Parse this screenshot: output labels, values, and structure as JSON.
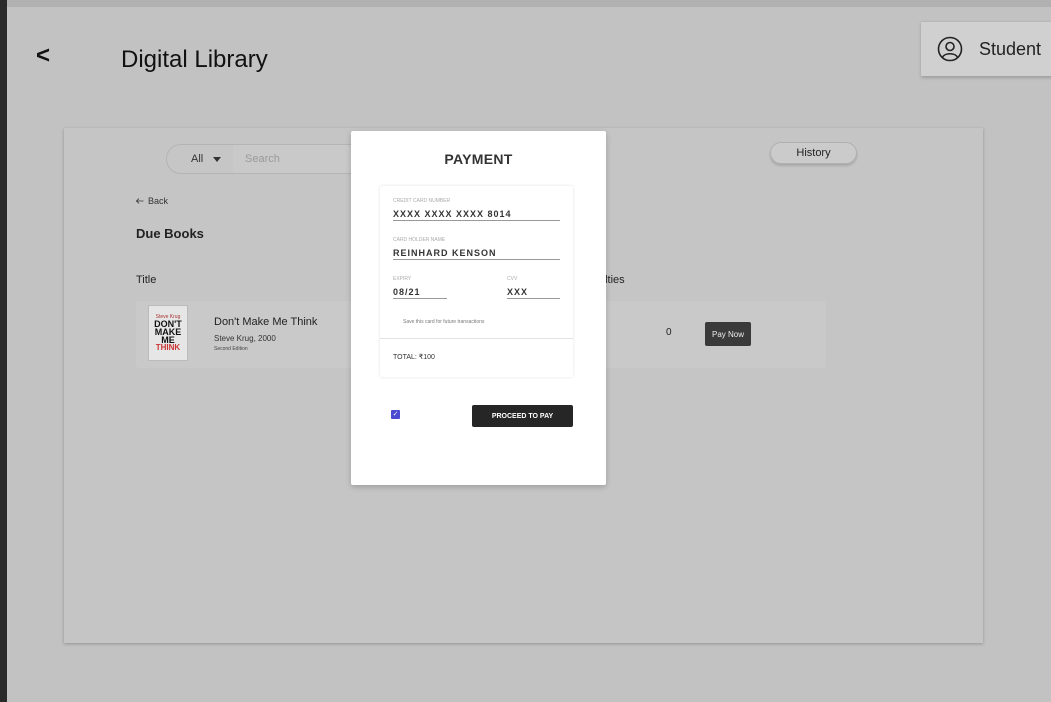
{
  "app": {
    "title": "Digital Library",
    "back_glyph": "<"
  },
  "user": {
    "label": "Student",
    "icon": "user-circle-icon"
  },
  "toolbar": {
    "filter": {
      "selected": "All"
    },
    "search": {
      "placeholder": "Search",
      "value": ""
    },
    "history_label": "History"
  },
  "content": {
    "back_label": "Back",
    "section_title": "Due Books",
    "columns": {
      "title": "Title",
      "penalties": "alties"
    },
    "books": [
      {
        "title": "Don't Make Me Think",
        "author_year": "Steve Krug, 2000",
        "edition": "Second Edition",
        "penalty_fragment": "0",
        "pay_label": "Pay Now",
        "cover": {
          "author": "Steve Krug",
          "line1": "DON'T",
          "line2": "MAKE",
          "line3": "ME",
          "line4": "THINK"
        }
      }
    ]
  },
  "payment": {
    "title": "PAYMENT",
    "card_number_label": "CREDIT CARD NUMBER",
    "card_number": "XXXX XXXX XXXX 8014",
    "holder_label": "CARD HOLDER NAME",
    "holder": "REINHARD KENSON",
    "expiry_label": "EXPIRY",
    "expiry": "08/21",
    "cvv_label": "CVV",
    "cvv": "XXX",
    "save_note": "Save this card for future transactions",
    "total": "TOTAL: ₹100",
    "proceed_label": "PROCEED TO PAY",
    "agree_checked": true
  },
  "colors": {
    "accent_checkbox": "#4b4bd1",
    "button_dark": "#262626"
  }
}
